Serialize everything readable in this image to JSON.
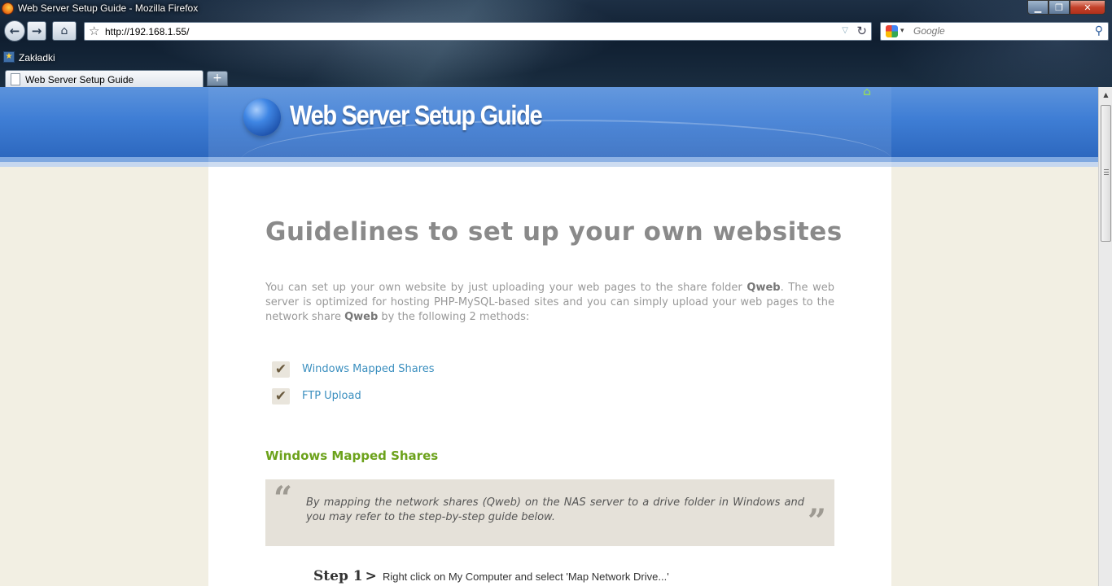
{
  "window": {
    "title": "Web Server Setup Guide - Mozilla Firefox",
    "controls": {
      "minimize": "▁",
      "maximize": "❐",
      "close": "✕"
    }
  },
  "navbar": {
    "back_glyph": "←",
    "forward_glyph": "→",
    "home_glyph": "⌂",
    "url": "http://192.168.1.55/",
    "star_glyph": "☆",
    "dropdown_glyph": "▽",
    "reload_glyph": "↻"
  },
  "search": {
    "placeholder": "Google",
    "dropdown_glyph": "▾",
    "button_glyph": "⚲"
  },
  "bookmarks": {
    "label": "Zakładki",
    "icon_glyph": "★"
  },
  "tabs": [
    {
      "label": "Web Server Setup Guide",
      "active": true
    }
  ],
  "new_tab_glyph": "+",
  "site": {
    "logo_text": "Web Server Setup Guide",
    "home_icon_glyph": "⌂"
  },
  "content": {
    "title": "Guidelines to set up your own websites",
    "intro": {
      "p1": "You can set up your own website by just uploading your web pages to the share folder ",
      "b1": "Qweb",
      "p2": ". The web server is optimized for hosting PHP-MySQL-based sites and you can simply upload your web pages to the network share ",
      "b2": "Qweb",
      "p3": " by the following 2 methods:"
    },
    "methods": [
      {
        "label": "Windows Mapped Shares",
        "check": "✔"
      },
      {
        "label": "FTP Upload",
        "check": "✔"
      }
    ],
    "section_heading": "Windows Mapped Shares",
    "quote": {
      "open": "“",
      "close": "”",
      "text": "By mapping the network shares (Qweb) on the NAS server to a drive folder in Windows and you may refer to the step-by-step guide below."
    },
    "step": {
      "label": "Step 1",
      "arrow": ">",
      "text": "Right click on My Computer and select 'Map Network Drive...'"
    }
  },
  "scrollbar": {
    "up_glyph": "▲"
  },
  "colors": {
    "header_blue": "#3f7ed5",
    "page_bg": "#f2efe3",
    "link": "#3b8fbf",
    "heading_green": "#6ca21b",
    "title_gray": "#8a8a8a"
  }
}
